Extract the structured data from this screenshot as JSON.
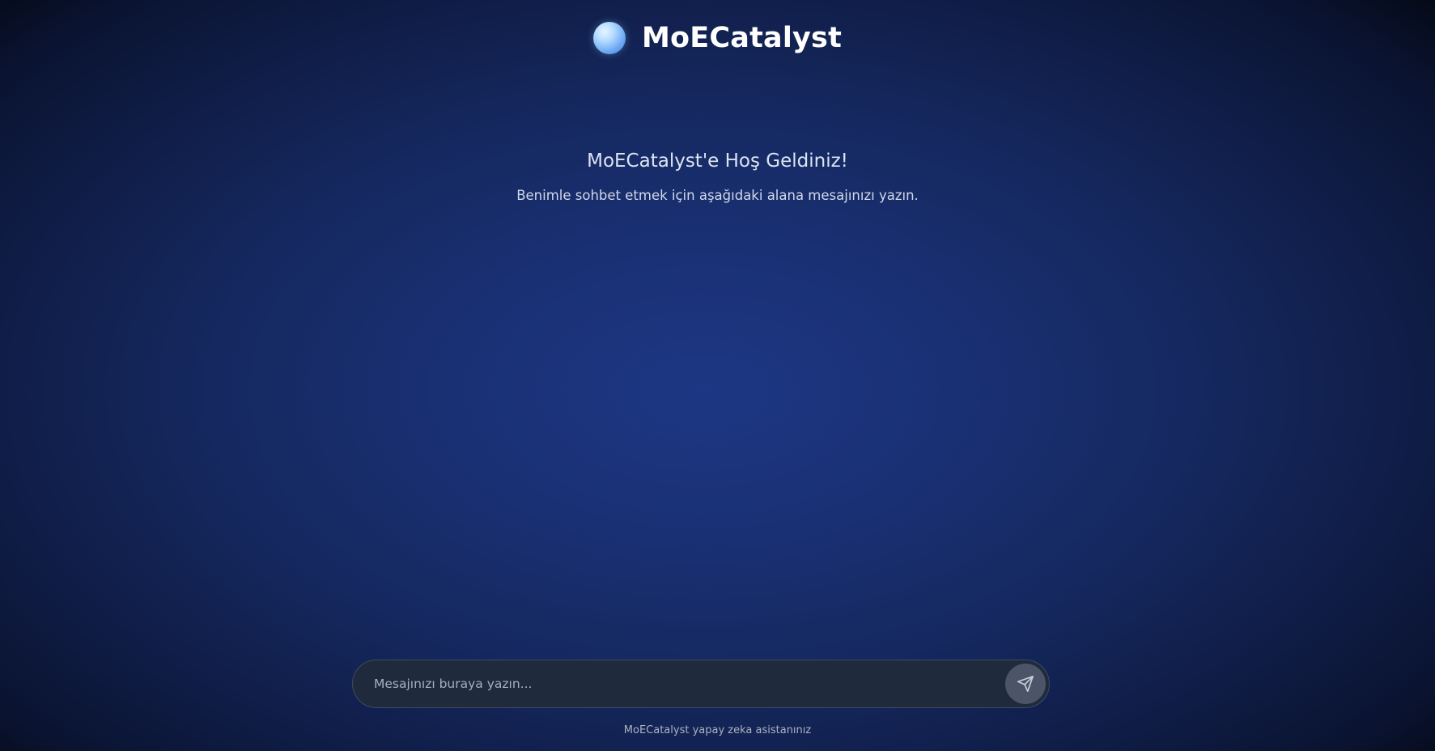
{
  "header": {
    "title": "MoECatalyst",
    "logo_icon": "glowing-orb-icon"
  },
  "welcome": {
    "title": "MoECatalyst'e Hoş Geldiniz!",
    "subtitle": "Benimle sohbet etmek için aşağıdaki alana mesajınızı yazın."
  },
  "composer": {
    "value": "",
    "placeholder": "Mesajınızı buraya yazın...",
    "send_icon": "send-icon"
  },
  "footer": {
    "note": "MoECatalyst yapay zeka asistanınız"
  },
  "colors": {
    "background_center": "#1d3784",
    "background_edge": "#03060f",
    "input_background": "#1f2a3c",
    "send_button": "#4b5567"
  }
}
